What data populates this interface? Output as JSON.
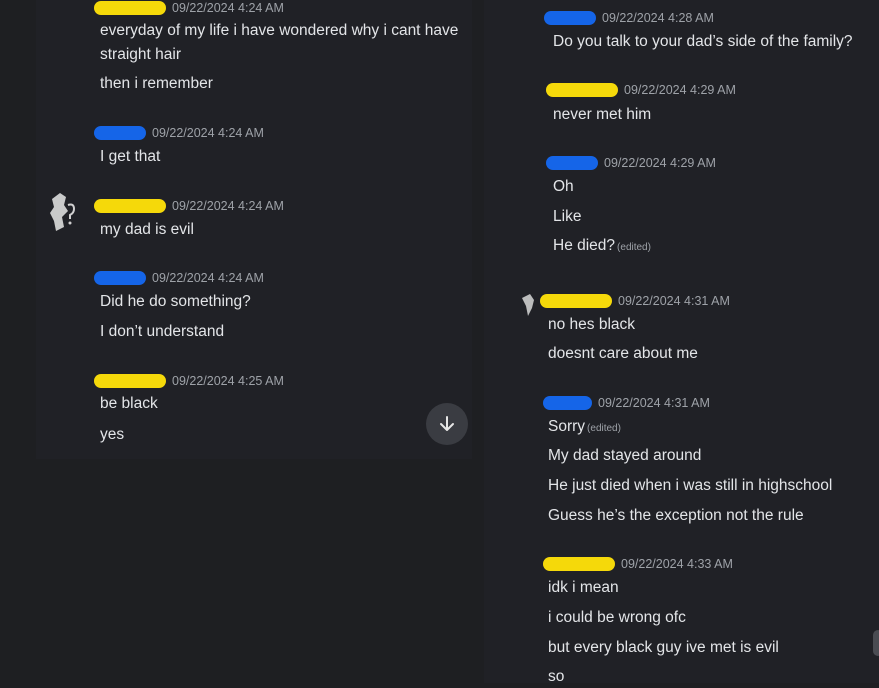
{
  "left_messages": [
    {
      "name_color": "#f5d90a",
      "timestamp": "09/22/2024 4:24 AM",
      "lines": [
        "everyday of my life i have wondered why i cant have",
        "straight hair",
        "then i remember"
      ]
    },
    {
      "name_color": "#1565e8",
      "timestamp": "09/22/2024 4:24 AM",
      "lines": [
        "I get that"
      ]
    },
    {
      "name_color": "#f5d90a",
      "timestamp": "09/22/2024 4:24 AM",
      "lines": [
        "my dad is evil"
      ]
    },
    {
      "name_color": "#1565e8",
      "timestamp": "09/22/2024 4:24 AM",
      "lines": [
        "Did he do something?",
        "I don’t understand"
      ]
    },
    {
      "name_color": "#f5d90a",
      "timestamp": "09/22/2024 4:25 AM",
      "lines": [
        "be black",
        "yes"
      ]
    }
  ],
  "right_messages": [
    {
      "name_color": "#1565e8",
      "timestamp": "09/22/2024 4:28 AM",
      "lines": [
        "Do you talk to your dad’s side of the family?"
      ]
    },
    {
      "name_color": "#f5d90a",
      "timestamp": "09/22/2024 4:29 AM",
      "lines": [
        "never met him"
      ]
    },
    {
      "name_color": "#1565e8",
      "timestamp": "09/22/2024 4:29 AM",
      "lines": [
        "Oh",
        "Like",
        "He died?"
      ],
      "edited_label": "(edited)"
    },
    {
      "name_color": "#f5d90a",
      "timestamp": "09/22/2024 4:31 AM",
      "lines": [
        "no hes black",
        "doesnt care about me"
      ]
    },
    {
      "name_color": "#1565e8",
      "timestamp": "09/22/2024 4:31 AM",
      "lines": [
        "Sorry",
        "My dad stayed around",
        "He just died when i was still in highschool",
        "Guess he’s the exception not the rule"
      ],
      "edited_label": "(edited)"
    },
    {
      "name_color": "#f5d90a",
      "timestamp": "09/22/2024 4:33 AM",
      "lines": [
        "idk i mean",
        "i could be wrong ofc",
        "but every black guy ive met is evil",
        "so"
      ]
    }
  ],
  "scroll_button_icon": "arrow-down-icon"
}
